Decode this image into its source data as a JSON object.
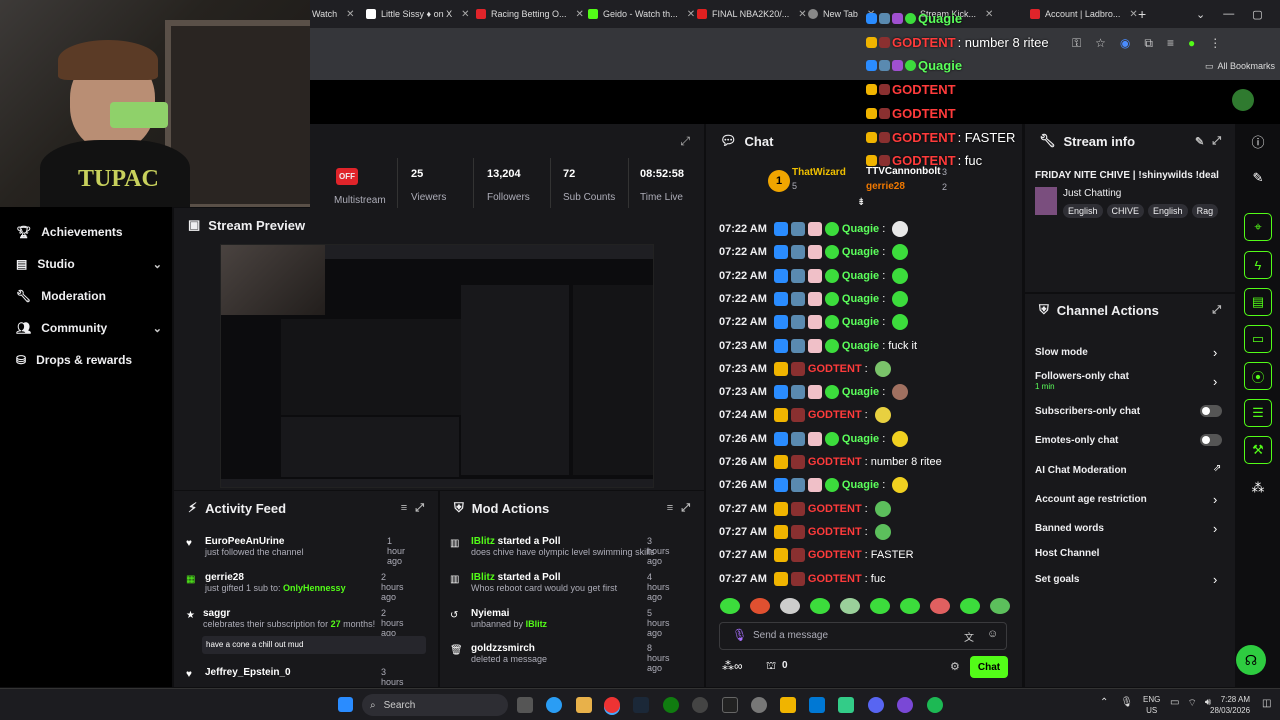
{
  "tabs": [
    "Watch",
    "Little Sissy ♦ on X",
    "Racing Betting O...",
    "Geido - Watch th...",
    "FINAL NBA2K20/...",
    "New Tab",
    "Stream Kick...",
    "Account | Ladbro..."
  ],
  "bookmarks": {
    "all": "All Bookmarks"
  },
  "overlay_chat": [
    {
      "user": "Quagie",
      "msg": ""
    },
    {
      "user": "GODTENT",
      "msg": ": number 8 ritee"
    },
    {
      "user": "Quagie",
      "msg": ""
    },
    {
      "user": "GODTENT",
      "msg": ""
    },
    {
      "user": "GODTENT",
      "msg": ""
    },
    {
      "user": "GODTENT",
      "msg": ": FASTER"
    },
    {
      "user": "GODTENT",
      "msg": ": fuc"
    }
  ],
  "stats": {
    "off": "OFF",
    "multistream": "Multistream",
    "viewers_v": "25",
    "viewers_l": "Viewers",
    "followers_v": "13,204",
    "followers_l": "Followers",
    "subs_v": "72",
    "subs_l": "Sub Counts",
    "time_v": "08:52:58",
    "time_l": "Time Live"
  },
  "sidebar": {
    "items": [
      {
        "label": "Achievements"
      },
      {
        "label": "Studio"
      },
      {
        "label": "Moderation"
      },
      {
        "label": "Community"
      },
      {
        "label": "Drops & rewards"
      }
    ]
  },
  "preview": {
    "title": "Stream Preview"
  },
  "activity": {
    "title": "Activity Feed",
    "items": [
      {
        "name": "EuroPeeAnUrine",
        "desc": "just followed the channel",
        "time": "1 hour ago"
      },
      {
        "name": "gerrie28",
        "desc": "just gifted 1 sub to: ",
        "desc2": "OnlyHennessy",
        "time": "2 hours ago"
      },
      {
        "name": "saggr",
        "desc": "celebrates their subscription for ",
        "desc2": "27",
        "desc3": " months!",
        "quote": "have a cone a chill out mud",
        "time": "2 hours ago"
      },
      {
        "name": "Jeffrey_Epstein_0",
        "time": "3 hours ago"
      }
    ]
  },
  "mod": {
    "title": "Mod Actions",
    "items": [
      {
        "name": "IBlitz",
        "act": " started a Poll",
        "desc": "does chive have olympic level swimming skills",
        "time": "3 hours ago"
      },
      {
        "name": "IBlitz",
        "act": " started a Poll",
        "desc": "Whos reboot card would you get first",
        "time": "4 hours ago"
      },
      {
        "name": "Nyiemai",
        "act": "",
        "desc": "unbanned by ",
        "desc2": "IBlitz",
        "time": "5 hours ago"
      },
      {
        "name": "goldzzsmirch",
        "act": "",
        "desc": "deleted a message",
        "time": "8 hours ago"
      }
    ]
  },
  "chat": {
    "title": "Chat",
    "leader": {
      "rank": "1",
      "top": "ThatWizard",
      "top_n": "5",
      "second": "TTVCannonbolt",
      "second_n": "3",
      "third": "gerrie28",
      "third_n": "2"
    },
    "lines": [
      {
        "time": "07:22 AM",
        "user": "Quagie",
        "msg": ":"
      },
      {
        "time": "07:22 AM",
        "user": "Quagie",
        "msg": ":"
      },
      {
        "time": "07:22 AM",
        "user": "Quagie",
        "msg": ":"
      },
      {
        "time": "07:22 AM",
        "user": "Quagie",
        "msg": ":"
      },
      {
        "time": "07:22 AM",
        "user": "Quagie",
        "msg": ":"
      },
      {
        "time": "07:23 AM",
        "user": "Quagie",
        "msg": ": fuck it"
      },
      {
        "time": "07:23 AM",
        "user": "GODTENT",
        "msg": ":"
      },
      {
        "time": "07:23 AM",
        "user": "Quagie",
        "msg": ":"
      },
      {
        "time": "07:24 AM",
        "user": "GODTENT",
        "msg": ":"
      },
      {
        "time": "07:26 AM",
        "user": "Quagie",
        "msg": ":"
      },
      {
        "time": "07:26 AM",
        "user": "GODTENT",
        "msg": ": number 8 ritee"
      },
      {
        "time": "07:26 AM",
        "user": "Quagie",
        "msg": ":"
      },
      {
        "time": "07:27 AM",
        "user": "GODTENT",
        "msg": ":"
      },
      {
        "time": "07:27 AM",
        "user": "GODTENT",
        "msg": ":"
      },
      {
        "time": "07:27 AM",
        "user": "GODTENT",
        "msg": ": FASTER"
      },
      {
        "time": "07:27 AM",
        "user": "GODTENT",
        "msg": ": fuc"
      }
    ],
    "placeholder": "Send a message",
    "points": "0",
    "send": "Chat"
  },
  "streaminfo": {
    "title": "Stream info",
    "stream_title": "FRIDAY NITE CHIVE | !shinywilds !deal",
    "category": "Just Chatting",
    "tags": [
      "English",
      "CHIVE",
      "English",
      "Rag"
    ]
  },
  "actions": {
    "title": "Channel Actions",
    "items": [
      {
        "label": "Slow mode"
      },
      {
        "label": "Followers-only chat",
        "sub": "1 min"
      },
      {
        "label": "Subscribers-only chat"
      },
      {
        "label": "Emotes-only chat"
      },
      {
        "label": "AI Chat Moderation"
      },
      {
        "label": "Account age restriction"
      },
      {
        "label": "Banned words"
      },
      {
        "label": "Host Channel"
      },
      {
        "label": "Set goals"
      }
    ]
  },
  "taskbar": {
    "search": "Search",
    "lang": "ENG",
    "region": "US",
    "time": "7:28 AM",
    "date": "28/03/2026"
  },
  "colors": {
    "accent": "#53fc18",
    "godtent": "#ff3b3b",
    "quagie": "#5bff5b",
    "panel": "#18181b"
  }
}
